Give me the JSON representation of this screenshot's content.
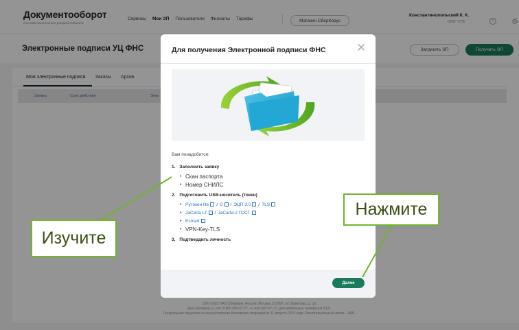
{
  "header": {
    "logo_title": "Документооборот",
    "logo_subtitle": "Система электронного документооборота",
    "nav": [
      "Сервисы",
      "Мои ЭП",
      "Пользователи",
      "Филиалы",
      "Тарифы"
    ],
    "active_nav": "Мои ЭП",
    "store_button": "Магазин СберКорус",
    "user_name": "Константинопольский К. К.",
    "user_org": "ООО \"СТВ\"",
    "help_glyph": "?",
    "gear_glyph": "⚙"
  },
  "page": {
    "title": "Электронные подписи УЦ ФНС",
    "upload_button": "Загрузить ЭП",
    "get_button": "Получить ЭП",
    "tabs": [
      "Мои электронные подписи",
      "Заказы",
      "Архив"
    ],
    "columns": [
      "Заявка",
      "Срок действия",
      "Элек"
    ]
  },
  "modal": {
    "title": "Для получения Электронной подписи ФНС",
    "close_glyph": "✕",
    "need_label": "Вам понадобится:",
    "steps": [
      {
        "num": "1.",
        "title": "Заполнить заявку",
        "items": [
          "Скан паспорта",
          "Номер СНИЛС"
        ]
      },
      {
        "num": "2.",
        "title": "Подготовить USB-носитель (токен)",
        "links_row1": [
          "Рутокен lite",
          "S",
          "ЭЦП 3.0",
          "TLS"
        ],
        "links_row2": [
          "JaCarta LT",
          "JaCarta-2 ГОСТ"
        ],
        "links_row3": [
          "Esmart"
        ],
        "plain_item": "VPN-Key-TLS"
      },
      {
        "num": "3.",
        "title": "Подтвердить личность"
      }
    ],
    "next_button": "Далее"
  },
  "footer": {
    "line1": "1997-2022 ПАО Сбербанк. Россия, Москва, 117997, ул. Вавилова, д. 19,",
    "line2": "www.sberbank.ru, тел. 8 800 555-57-77, +7 495 665-57-77, для мобильных телефонов 0321.",
    "line3": "Генеральная лицензия на осуществление банковских операций от 11 августа 2015 года. Регистрационный номер - 1481."
  },
  "annotations": {
    "study": "Изучите",
    "press": "Нажмите"
  },
  "colors": {
    "accent": "#1a7a5c",
    "link": "#2272c9",
    "callout_border": "#70b52b"
  }
}
